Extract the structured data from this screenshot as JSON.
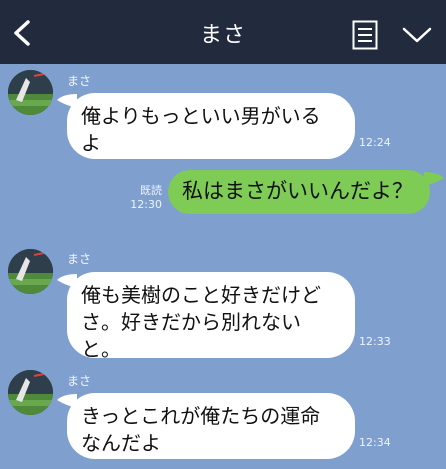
{
  "header": {
    "title": "まさ",
    "back_icon": "chevron-left-icon",
    "memo_icon": "notes-icon",
    "menu_icon": "chevron-down-icon"
  },
  "colors": {
    "header_bg": "#222a3e",
    "chat_bg": "#7fa0cf",
    "incoming_bubble": "#ffffff",
    "outgoing_bubble": "#7ecb55"
  },
  "messages": [
    {
      "sender": "まさ",
      "text": "俺よりもっといい男がいるよ",
      "time": "12:24"
    },
    {
      "sender": "me",
      "text": "私はまさがいいんだよ？",
      "read": "既読",
      "time": "12:30"
    },
    {
      "sender": "まさ",
      "text": "俺も美樹のこと好きだけどさ。好きだから別れないと。",
      "time": "12:33"
    },
    {
      "sender": "まさ",
      "text": "きっとこれが俺たちの運命なんだよ",
      "time": "12:34"
    }
  ]
}
